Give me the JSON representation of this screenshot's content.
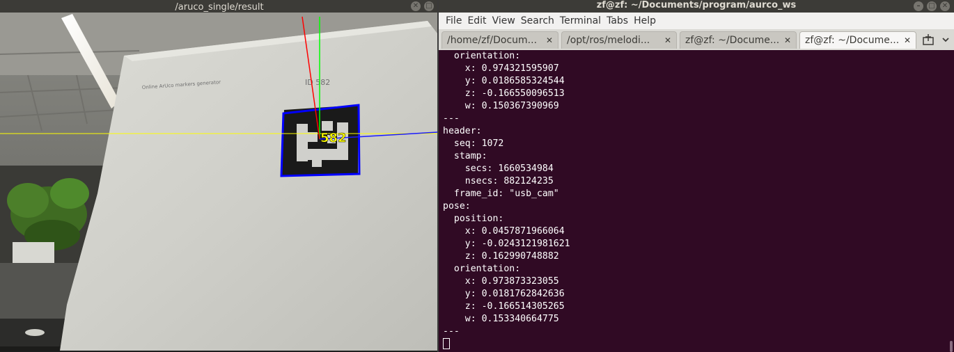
{
  "camera_window": {
    "title": "/aruco_single/result",
    "marker_label": "582",
    "printed_id": "ID 582",
    "paper_caption": "Online ArUco markers generator"
  },
  "terminal_window": {
    "title": "zf@zf: ~/Documents/program/aurco_ws",
    "menu": [
      "File",
      "Edit",
      "View",
      "Search",
      "Terminal",
      "Tabs",
      "Help"
    ],
    "tabs": [
      {
        "label": "/home/zf/Docum...",
        "active": false
      },
      {
        "label": "/opt/ros/melodi...",
        "active": false
      },
      {
        "label": "zf@zf: ~/Docume...",
        "active": false
      },
      {
        "label": "zf@zf: ~/Docume...",
        "active": true
      }
    ],
    "lines": [
      "  orientation:",
      "    x: 0.974321595907",
      "    y: 0.0186585324544",
      "    z: -0.166550096513",
      "    w: 0.150367390969",
      "---",
      "header:",
      "  seq: 1072",
      "  stamp:",
      "    secs: 1660534984",
      "    nsecs: 882124235",
      "  frame_id: \"usb_cam\"",
      "pose:",
      "  position:",
      "    x: 0.0457871966064",
      "    y: -0.0243121981621",
      "    z: 0.162990748882",
      "  orientation:",
      "    x: 0.973873323055",
      "    y: 0.0181762842636",
      "    z: -0.166514305265",
      "    w: 0.153340664775",
      "---"
    ]
  },
  "colors": {
    "terminal_bg": "#300a24",
    "title_bar": "#3c3b37",
    "marker_outline": "#0000ff",
    "axis_x": "#ff0000",
    "axis_y": "#00ff00",
    "axis_z": "#0000ff",
    "guide_line": "#ffff00",
    "marker_label": "#ffff00"
  },
  "icons": [
    "close-icon",
    "new-tab-icon",
    "tab-menu-icon"
  ]
}
